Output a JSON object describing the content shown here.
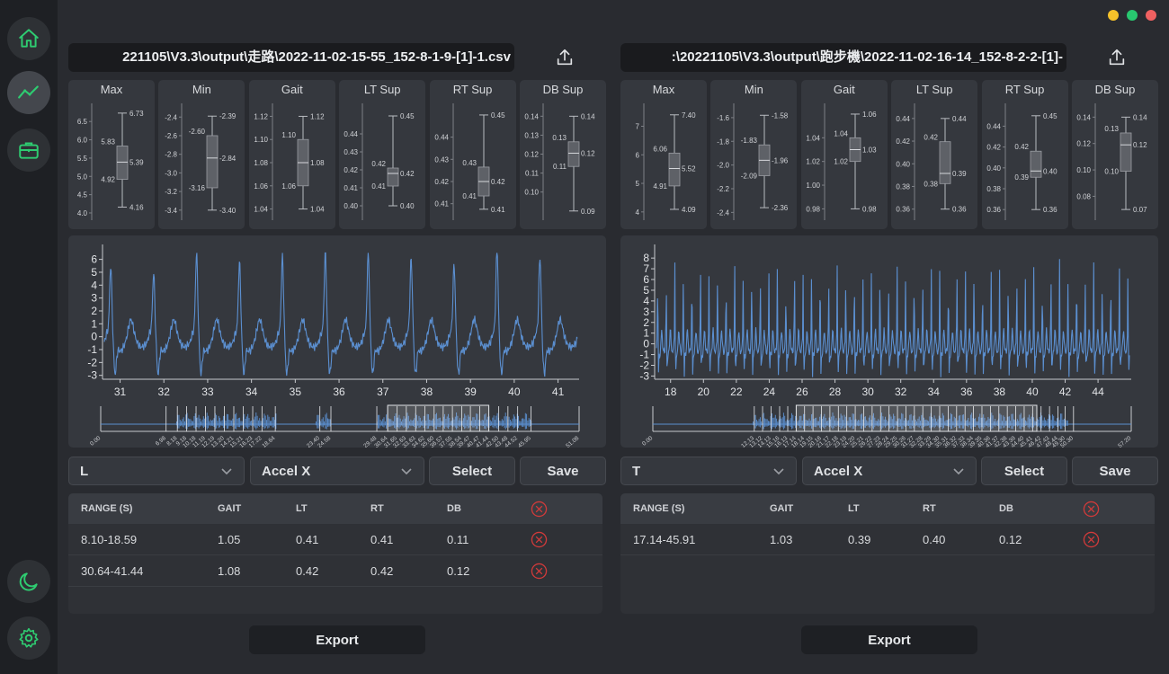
{
  "theme": {
    "accent": "#2ecc71",
    "line": "#5b8fd0",
    "danger": "#d03a3a"
  },
  "window_controls": [
    {
      "name": "minimize",
      "color": "#f5c22a"
    },
    {
      "name": "maximize",
      "color": "#28c76f"
    },
    {
      "name": "close",
      "color": "#ef6161"
    }
  ],
  "sidebar": {
    "items": [
      {
        "name": "home",
        "icon": "home-icon"
      },
      {
        "name": "analysis",
        "icon": "chart-line-icon",
        "active": true
      },
      {
        "name": "toolbox",
        "icon": "briefcase-icon"
      }
    ],
    "bottom": [
      {
        "name": "theme",
        "icon": "moon-icon"
      },
      {
        "name": "settings",
        "icon": "gear-icon"
      }
    ]
  },
  "panels": [
    {
      "file_path": "221105\\V3.3\\output\\走路\\2022-11-02-15-55_152-8-1-9-[1]-1.csv",
      "stats": [
        {
          "title": "Max",
          "ticks": [
            "6.5",
            "6.0",
            "5.5",
            "5.0",
            "4.5",
            "4.0"
          ],
          "tick_vals": [
            6.5,
            6.0,
            5.5,
            5.0,
            4.5,
            4.0
          ],
          "ymin": 3.95,
          "ymax": 6.8,
          "box": {
            "max": "6.73",
            "q3": "5.83",
            "median": "5.39",
            "q1": "4.92",
            "min": "4.16"
          },
          "box_vals": {
            "max": 6.73,
            "q3": 5.83,
            "median": 5.39,
            "q1": 4.92,
            "min": 4.16
          }
        },
        {
          "title": "Min",
          "ticks": [
            "-2.4",
            "-2.6",
            "-2.8",
            "-3.0",
            "-3.2",
            "-3.4"
          ],
          "tick_vals": [
            -2.4,
            -2.6,
            -2.8,
            -3.0,
            -3.2,
            -3.4
          ],
          "ymin": -3.45,
          "ymax": -2.33,
          "box": {
            "max": "-2.39",
            "q3": "-2.60",
            "median": "-2.84",
            "q1": "-3.16",
            "min": "-3.40"
          },
          "box_vals": {
            "max": -2.39,
            "q3": -2.6,
            "median": -2.84,
            "q1": -3.16,
            "min": -3.4
          }
        },
        {
          "title": "Gait",
          "ticks": [
            "1.12",
            "1.10",
            "1.08",
            "1.06",
            "1.04"
          ],
          "tick_vals": [
            1.12,
            1.1,
            1.08,
            1.06,
            1.04
          ],
          "ymin": 1.035,
          "ymax": 1.125,
          "box": {
            "max": "1.12",
            "q3": "1.10",
            "median": "1.08",
            "q1": "1.06",
            "min": "1.04"
          },
          "box_vals": {
            "max": 1.12,
            "q3": 1.1,
            "median": 1.08,
            "q1": 1.06,
            "min": 1.04
          }
        },
        {
          "title": "LT Sup",
          "ticks": [
            "0.44",
            "0.43",
            "0.42",
            "0.41",
            "0.40"
          ],
          "tick_vals": [
            0.44,
            0.43,
            0.42,
            0.41,
            0.4
          ],
          "ymin": 0.395,
          "ymax": 0.453,
          "box": {
            "max": "0.45",
            "q3": "0.42",
            "median": "0.42",
            "q1": "0.41",
            "min": "0.40"
          },
          "box_vals": {
            "max": 0.45,
            "q3": 0.421,
            "median": 0.418,
            "q1": 0.411,
            "min": 0.4
          }
        },
        {
          "title": "RT Sup",
          "ticks": [
            "0.44",
            "0.43",
            "0.42",
            "0.41"
          ],
          "tick_vals": [
            0.44,
            0.43,
            0.42,
            0.41
          ],
          "ymin": 0.405,
          "ymax": 0.452,
          "box": {
            "max": "0.45",
            "q3": "0.43",
            "median": "0.42",
            "q1": "0.41",
            "min": "0.41"
          },
          "box_vals": {
            "max": 0.45,
            "q3": 0.4265,
            "median": 0.42,
            "q1": 0.4135,
            "min": 0.4075
          }
        },
        {
          "title": "DB Sup",
          "ticks": [
            "0.14",
            "0.13",
            "0.12",
            "0.11",
            "0.10"
          ],
          "tick_vals": [
            0.14,
            0.13,
            0.12,
            0.11,
            0.1
          ],
          "ymin": 0.088,
          "ymax": 0.143,
          "box": {
            "max": "0.14",
            "q3": "0.13",
            "median": "0.12",
            "q1": "0.11",
            "min": "0.09"
          },
          "box_vals": {
            "max": 0.14,
            "q3": 0.1265,
            "median": 0.1205,
            "q1": 0.1135,
            "min": 0.09
          }
        }
      ],
      "signal": {
        "x_ticks": [
          "31",
          "32",
          "33",
          "34",
          "35",
          "36",
          "37",
          "38",
          "39",
          "40",
          "41"
        ],
        "x_range": [
          30.64,
          41.44
        ],
        "y_ticks": [
          "6",
          "5",
          "4",
          "3",
          "2",
          "1",
          "0",
          "-1",
          "-2",
          "-3"
        ],
        "y_range": [
          -3.3,
          6.6
        ],
        "period": 0.98,
        "peak_values": [
          5.0,
          4.5,
          6.1,
          5.3,
          5.8,
          6.3,
          6.1,
          5.6,
          5.2,
          6.4,
          5.7,
          5.9
        ],
        "overview": {
          "range": [
            0,
            51.08
          ],
          "start_label": "0.00",
          "end_label": "51.08",
          "selection": [
            30.64,
            41.44
          ],
          "active_segments": [
            [
              8.1,
              18.8
            ],
            [
              23.0,
              24.6
            ],
            [
              29.5,
              46.0
            ]
          ],
          "segment_labels": [
            "6.98",
            "8.18",
            "9.18",
            "10.18",
            "11.19",
            "12.19",
            "13.20",
            "14.21",
            "15.21",
            "16.23",
            "17.22",
            "18.64",
            "23.40",
            "24.58",
            "29.48",
            "30.64",
            "31.65",
            "32.63",
            "33.63",
            "34.62",
            "35.60",
            "36.57",
            "37.55",
            "38.54",
            "39.47",
            "40.47",
            "41.44",
            "42.50",
            "43.48",
            "44.52",
            "45.95"
          ]
        }
      },
      "selects": {
        "leg": "L",
        "channel": "Accel X"
      },
      "buttons": {
        "select": "Select",
        "save": "Save",
        "export": "Export"
      },
      "table": {
        "headers": [
          "RANGE (S)",
          "GAIT",
          "LT",
          "RT",
          "DB"
        ],
        "rows": [
          [
            "8.10-18.59",
            "1.05",
            "0.41",
            "0.41",
            "0.11"
          ],
          [
            "30.64-41.44",
            "1.08",
            "0.42",
            "0.42",
            "0.12"
          ]
        ]
      }
    },
    {
      "file_path": ":\\20221105\\V3.3\\output\\跑步機\\2022-11-02-16-14_152-8-2-2-[1]-",
      "stats": [
        {
          "title": "Max",
          "ticks": [
            "7",
            "6",
            "5",
            "4"
          ],
          "tick_vals": [
            7,
            6,
            5,
            4
          ],
          "ymin": 3.9,
          "ymax": 7.55,
          "box": {
            "max": "7.40",
            "q3": "6.06",
            "median": "5.52",
            "q1": "4.91",
            "min": "4.09"
          },
          "box_vals": {
            "max": 7.4,
            "q3": 6.06,
            "median": 5.52,
            "q1": 4.91,
            "min": 4.09
          }
        },
        {
          "title": "Min",
          "ticks": [
            "-1.6",
            "-1.8",
            "-2.0",
            "-2.2",
            "-2.4"
          ],
          "tick_vals": [
            -1.6,
            -1.8,
            -2.0,
            -2.2,
            -2.4
          ],
          "ymin": -2.42,
          "ymax": -1.54,
          "box": {
            "max": "-1.58",
            "q3": "-1.83",
            "median": "-1.96",
            "q1": "-2.09",
            "min": "-2.36"
          },
          "box_vals": {
            "max": -1.58,
            "q3": -1.83,
            "median": -1.96,
            "q1": -2.09,
            "min": -2.36
          }
        },
        {
          "title": "Gait",
          "ticks": [
            "1.04",
            "1.02",
            "1.00",
            "0.98"
          ],
          "tick_vals": [
            1.04,
            1.02,
            1.0,
            0.98
          ],
          "ymin": 0.975,
          "ymax": 1.063,
          "box": {
            "max": "1.06",
            "q3": "1.04",
            "median": "1.03",
            "q1": "1.02",
            "min": "0.98"
          },
          "box_vals": {
            "max": 1.06,
            "q3": 1.04,
            "median": 1.03,
            "q1": 1.02,
            "min": 0.98
          }
        },
        {
          "title": "LT Sup",
          "ticks": [
            "0.44",
            "0.42",
            "0.40",
            "0.38",
            "0.36"
          ],
          "tick_vals": [
            0.44,
            0.42,
            0.4,
            0.38,
            0.36
          ],
          "ymin": 0.355,
          "ymax": 0.447,
          "box": {
            "max": "0.44",
            "q3": "0.42",
            "median": "0.39",
            "q1": "0.38",
            "min": "0.36"
          },
          "box_vals": {
            "max": 0.44,
            "q3": 0.4195,
            "median": 0.3915,
            "q1": 0.3825,
            "min": 0.36
          }
        },
        {
          "title": "RT Sup",
          "ticks": [
            "0.44",
            "0.42",
            "0.40",
            "0.38",
            "0.36"
          ],
          "tick_vals": [
            0.44,
            0.42,
            0.4,
            0.38,
            0.36
          ],
          "ymin": 0.355,
          "ymax": 0.455,
          "box": {
            "max": "0.45",
            "q3": "0.42",
            "median": "0.40",
            "q1": "0.39",
            "min": "0.36"
          },
          "box_vals": {
            "max": 0.45,
            "q3": 0.416,
            "median": 0.397,
            "q1": 0.391,
            "min": 0.36
          }
        },
        {
          "title": "DB Sup",
          "ticks": [
            "0.14",
            "0.12",
            "0.10",
            "0.08"
          ],
          "tick_vals": [
            0.14,
            0.12,
            0.1,
            0.08
          ],
          "ymin": 0.066,
          "ymax": 0.145,
          "box": {
            "max": "0.14",
            "q3": "0.13",
            "median": "0.12",
            "q1": "0.10",
            "min": "0.07"
          },
          "box_vals": {
            "max": 0.14,
            "q3": 0.128,
            "median": 0.119,
            "q1": 0.099,
            "min": 0.07
          }
        }
      ],
      "signal": {
        "x_ticks": [
          "18",
          "20",
          "22",
          "24",
          "26",
          "28",
          "30",
          "32",
          "34",
          "36",
          "38",
          "40",
          "42",
          "44"
        ],
        "x_range": [
          17.14,
          45.91
        ],
        "y_ticks": [
          "8",
          "7",
          "6",
          "5",
          "4",
          "3",
          "2",
          "1",
          "0",
          "-1",
          "-2",
          "-3"
        ],
        "y_range": [
          -3.3,
          8.6
        ],
        "period": 0.52,
        "peak_values": [
          6.8,
          5.6,
          7.2,
          6.0,
          6.5,
          7.4,
          5.9,
          6.9,
          6.3,
          7.1,
          5.8,
          6.6,
          7.0,
          6.2
        ],
        "overview": {
          "range": [
            0,
            57.2
          ],
          "start_label": "0.00",
          "end_label": "57.20",
          "selection": [
            17.14,
            45.91
          ],
          "active_segments": [
            [
              12.0,
              49.6
            ]
          ],
          "segment_labels": [
            "12.13",
            "13.12",
            "14.13",
            "15.16",
            "16.13",
            "17.14",
            "18.14",
            "19.15",
            "20.16",
            "21.17",
            "22.18",
            "23.19",
            "24.20",
            "25.21",
            "26.22",
            "27.23",
            "28.24",
            "29.25",
            "30.26",
            "31.27",
            "32.28",
            "33.29",
            "34.30",
            "35.31",
            "36.32",
            "37.33",
            "38.34",
            "39.35",
            "40.36",
            "41.37",
            "42.38",
            "43.39",
            "44.40",
            "45.41",
            "46.42",
            "47.43",
            "48.44",
            "49.30",
            "50.30"
          ]
        }
      },
      "selects": {
        "leg": "T",
        "channel": "Accel X"
      },
      "buttons": {
        "select": "Select",
        "save": "Save",
        "export": "Export"
      },
      "table": {
        "headers": [
          "RANGE (S)",
          "GAIT",
          "LT",
          "RT",
          "DB"
        ],
        "rows": [
          [
            "17.14-45.91",
            "1.03",
            "0.39",
            "0.40",
            "0.12"
          ]
        ]
      }
    }
  ]
}
